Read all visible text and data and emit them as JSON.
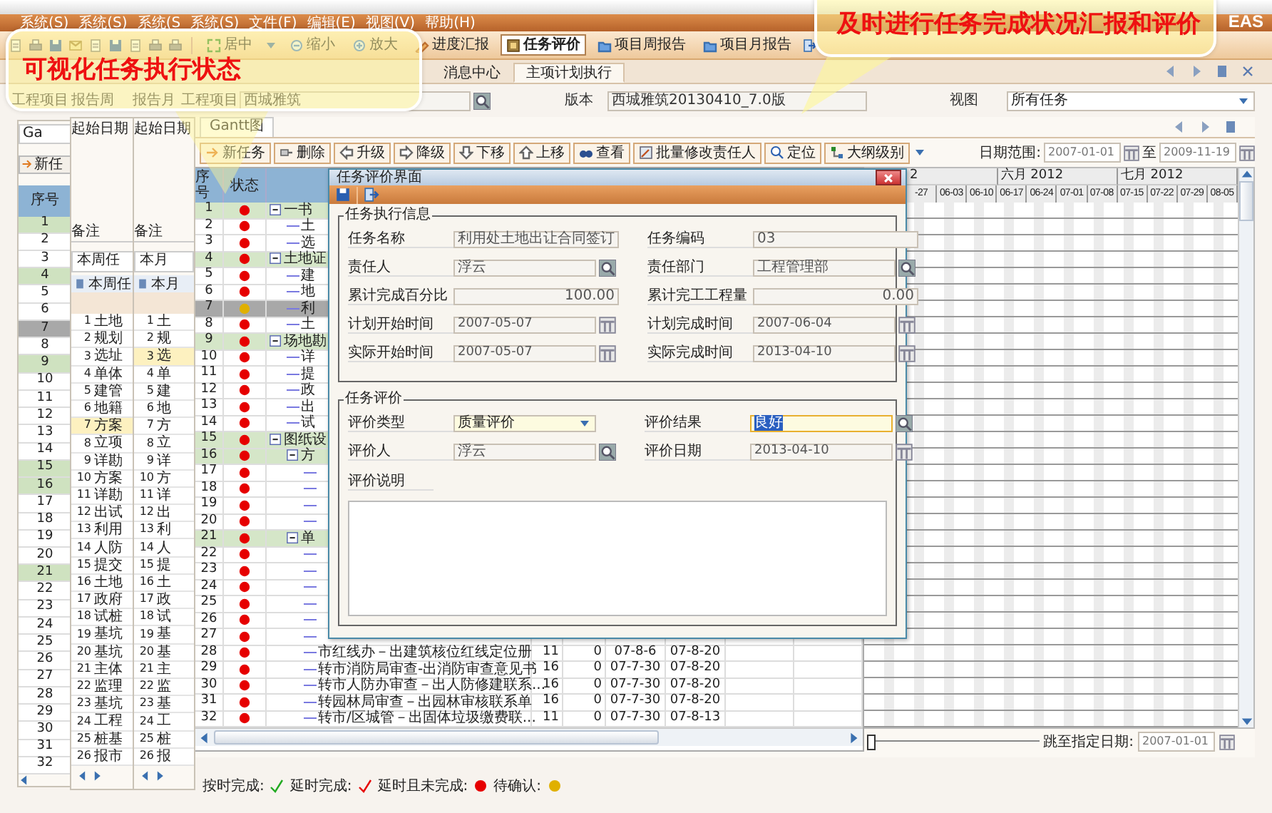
{
  "menu_bar": {
    "items": [
      "系统(S)",
      "系统(S)",
      "系统(S",
      "系统(S)",
      "文件(F)",
      "编辑(E)",
      "视图(V)",
      "帮助(H)"
    ],
    "logo": "EAS"
  },
  "main_toolbar": {
    "buttons": [
      {
        "label": "居中",
        "kind": "center",
        "selected": false
      },
      {
        "label": "缩小",
        "kind": "zoom_out",
        "selected": false
      },
      {
        "label": "放大",
        "kind": "zoom_in",
        "selected": false
      },
      {
        "label": "进度汇报",
        "kind": "report",
        "selected": false
      },
      {
        "label": "任务评价",
        "kind": "evaluate",
        "selected": true
      },
      {
        "label": "项目周报告",
        "kind": "folder",
        "selected": false
      },
      {
        "label": "项目月报告",
        "kind": "folder",
        "selected": false
      }
    ]
  },
  "callouts": [
    {
      "text": "可视化任务执行状态"
    },
    {
      "text": "及时进行任务完成状况汇报和评价"
    }
  ],
  "window_tabs": [
    {
      "label": "消息中心",
      "selected": false
    },
    {
      "label": "主项计划执行",
      "selected": true
    }
  ],
  "filters": {
    "project_label": "工程项目",
    "week_label": "报告周",
    "month_label": "报告月",
    "project_label_2": "工程项目",
    "project": "西城雅筑",
    "version_label": "版本",
    "version": "西城雅筑20130410_7.0版",
    "view_label": "视图",
    "view": "所有任务"
  },
  "left_window": {
    "tab": "Ga",
    "button": "新任",
    "column": "序号",
    "rows": [
      {
        "no": "1",
        "summary": true,
        "selected": false
      },
      {
        "no": "2",
        "summary": false,
        "selected": false
      },
      {
        "no": "3",
        "summary": false,
        "selected": false
      },
      {
        "no": "4",
        "summary": true,
        "selected": false
      },
      {
        "no": "5",
        "summary": false,
        "selected": false
      },
      {
        "no": "6",
        "summary": false,
        "selected": false
      },
      {
        "no": "7",
        "summary": false,
        "selected": true
      },
      {
        "no": "8",
        "summary": false,
        "selected": false
      },
      {
        "no": "9",
        "summary": true,
        "selected": false
      },
      {
        "no": "10",
        "summary": false,
        "selected": false
      },
      {
        "no": "11",
        "summary": false,
        "selected": false
      },
      {
        "no": "12",
        "summary": false,
        "selected": false
      },
      {
        "no": "13",
        "summary": false,
        "selected": false
      },
      {
        "no": "14",
        "summary": false,
        "selected": false
      },
      {
        "no": "15",
        "summary": true,
        "selected": false
      },
      {
        "no": "16",
        "summary": true,
        "selected": false
      },
      {
        "no": "17",
        "summary": false,
        "selected": false
      },
      {
        "no": "18",
        "summary": false,
        "selected": false
      },
      {
        "no": "19",
        "summary": false,
        "selected": false
      },
      {
        "no": "20",
        "summary": false,
        "selected": false
      },
      {
        "no": "21",
        "summary": true,
        "selected": false
      },
      {
        "no": "22",
        "summary": false,
        "selected": false
      },
      {
        "no": "23",
        "summary": false,
        "selected": false
      },
      {
        "no": "24",
        "summary": false,
        "selected": false
      },
      {
        "no": "25",
        "summary": false,
        "selected": false
      },
      {
        "no": "26",
        "summary": false,
        "selected": false
      },
      {
        "no": "27",
        "summary": false,
        "selected": false
      },
      {
        "no": "28",
        "summary": false,
        "selected": false
      },
      {
        "no": "29",
        "summary": false,
        "selected": false
      },
      {
        "no": "30",
        "summary": false,
        "selected": false
      },
      {
        "no": "31",
        "summary": false,
        "selected": false
      },
      {
        "no": "32",
        "summary": false,
        "selected": false
      }
    ]
  },
  "week_window": {
    "start_label": "起始日期",
    "note_label": "备注",
    "tab": "本周任",
    "header": "本周任",
    "rows": [
      {
        "no": "1",
        "name": "土地",
        "selected": false
      },
      {
        "no": "2",
        "name": "规划",
        "selected": false
      },
      {
        "no": "3",
        "name": "选址",
        "selected": false
      },
      {
        "no": "4",
        "name": "单体",
        "selected": false
      },
      {
        "no": "5",
        "name": "建管",
        "selected": false
      },
      {
        "no": "6",
        "name": "地籍",
        "selected": false
      },
      {
        "no": "7",
        "name": "方案",
        "selected": true
      },
      {
        "no": "8",
        "name": "立项",
        "selected": false
      },
      {
        "no": "9",
        "name": "详勘",
        "selected": false
      },
      {
        "no": "10",
        "name": "方案",
        "selected": false
      },
      {
        "no": "11",
        "name": "详勘",
        "selected": false
      },
      {
        "no": "12",
        "name": "出试",
        "selected": false
      },
      {
        "no": "13",
        "name": "利用",
        "selected": false
      },
      {
        "no": "14",
        "name": "人防",
        "selected": false
      },
      {
        "no": "15",
        "name": "提交",
        "selected": false
      },
      {
        "no": "16",
        "name": "土地",
        "selected": false
      },
      {
        "no": "17",
        "name": "政府",
        "selected": false
      },
      {
        "no": "18",
        "name": "试桩",
        "selected": false
      },
      {
        "no": "19",
        "name": "基坑",
        "selected": false
      },
      {
        "no": "20",
        "name": "基坑",
        "selected": false
      },
      {
        "no": "21",
        "name": "主体",
        "selected": false
      },
      {
        "no": "22",
        "name": "监理",
        "selected": false
      },
      {
        "no": "23",
        "name": "基坑",
        "selected": false
      },
      {
        "no": "24",
        "name": "工程",
        "selected": false
      },
      {
        "no": "25",
        "name": "桩基",
        "selected": false
      },
      {
        "no": "26",
        "name": "报市",
        "selected": false
      }
    ]
  },
  "month_window": {
    "start_label": "起始日期",
    "note_label": "备注",
    "tab": "本月",
    "header": "本月",
    "rows": [
      {
        "no": "1",
        "name": "土",
        "selected": false
      },
      {
        "no": "2",
        "name": "规",
        "selected": false
      },
      {
        "no": "3",
        "name": "选",
        "selected": true
      },
      {
        "no": "4",
        "name": "单",
        "selected": false
      },
      {
        "no": "5",
        "name": "建",
        "selected": false
      },
      {
        "no": "6",
        "name": "地",
        "selected": false
      },
      {
        "no": "7",
        "name": "方",
        "selected": false
      },
      {
        "no": "8",
        "name": "立",
        "selected": false
      },
      {
        "no": "9",
        "name": "详",
        "selected": false
      },
      {
        "no": "10",
        "name": "方",
        "selected": false
      },
      {
        "no": "11",
        "name": "详",
        "selected": false
      },
      {
        "no": "12",
        "name": "出",
        "selected": false
      },
      {
        "no": "13",
        "name": "利",
        "selected": false
      },
      {
        "no": "14",
        "name": "人",
        "selected": false
      },
      {
        "no": "15",
        "name": "提",
        "selected": false
      },
      {
        "no": "16",
        "name": "土",
        "selected": false
      },
      {
        "no": "17",
        "name": "政",
        "selected": false
      },
      {
        "no": "18",
        "name": "试",
        "selected": false
      },
      {
        "no": "19",
        "name": "基",
        "selected": false
      },
      {
        "no": "20",
        "name": "基",
        "selected": false
      },
      {
        "no": "21",
        "name": "主",
        "selected": false
      },
      {
        "no": "22",
        "name": "监",
        "selected": false
      },
      {
        "no": "23",
        "name": "基",
        "selected": false
      },
      {
        "no": "24",
        "name": "工",
        "selected": false
      },
      {
        "no": "25",
        "name": "桩",
        "selected": false
      },
      {
        "no": "26",
        "name": "报",
        "selected": false
      }
    ]
  },
  "gantt": {
    "tab": "Gantt图",
    "toolbar": [
      {
        "label": "新任务",
        "kind": "new"
      },
      {
        "label": "删除",
        "kind": "delete"
      },
      {
        "label": "升级",
        "kind": "promote"
      },
      {
        "label": "降级",
        "kind": "demote"
      },
      {
        "label": "下移",
        "kind": "down"
      },
      {
        "label": "上移",
        "kind": "up"
      },
      {
        "label": "查看",
        "kind": "view"
      },
      {
        "label": "批量修改责任人",
        "kind": "reassign"
      },
      {
        "label": "定位",
        "kind": "locate"
      },
      {
        "label": "大纲级别",
        "kind": "outline"
      }
    ],
    "date_range": {
      "label": "日期范围:",
      "from": "2007-01-01",
      "to_label": "至",
      "to": "2009-11-19"
    },
    "columns": [
      "序号",
      "状态"
    ],
    "rows": [
      {
        "no": "1",
        "color": "#e60000",
        "name": "一书",
        "summary": true,
        "selected": false,
        "expanded": true,
        "children": [
          {
            "no": "2",
            "color": "#e60000",
            "name": "土",
            "summary": false,
            "selected": false
          },
          {
            "no": "3",
            "color": "#e60000",
            "name": "选",
            "summary": false,
            "selected": false
          }
        ]
      },
      {
        "no": "4",
        "color": "#e60000",
        "name": "土地证",
        "summary": true,
        "selected": false,
        "expanded": true,
        "children": [
          {
            "no": "5",
            "color": "#e60000",
            "name": "建",
            "summary": false,
            "selected": false
          },
          {
            "no": "6",
            "color": "#e60000",
            "name": "地",
            "summary": false,
            "selected": false
          },
          {
            "no": "7",
            "color": "#e0b000",
            "name": "利",
            "summary": false,
            "selected": true
          },
          {
            "no": "8",
            "color": "#e60000",
            "name": "土",
            "summary": false,
            "selected": false
          }
        ]
      },
      {
        "no": "9",
        "color": "#e60000",
        "name": "场地勘",
        "summary": true,
        "selected": false,
        "expanded": true,
        "children": [
          {
            "no": "10",
            "color": "#e60000",
            "name": "详",
            "summary": false,
            "selected": false
          },
          {
            "no": "11",
            "color": "#e60000",
            "name": "提",
            "summary": false,
            "selected": false
          },
          {
            "no": "12",
            "color": "#e60000",
            "name": "政",
            "summary": false,
            "selected": false
          },
          {
            "no": "13",
            "color": "#e60000",
            "name": "出",
            "summary": false,
            "selected": false
          },
          {
            "no": "14",
            "color": "#e60000",
            "name": "试",
            "summary": false,
            "selected": false
          }
        ]
      },
      {
        "no": "15",
        "color": "#e60000",
        "name": "图纸设",
        "summary": true,
        "selected": false,
        "expanded": true,
        "children": [
          {
            "no": "16",
            "color": "#e60000",
            "name": "方",
            "summary": true,
            "selected": false,
            "expanded": true,
            "children": [
              {
                "no": "17",
                "color": "#e60000",
                "summary": false,
                "selected": false
              },
              {
                "no": "18",
                "color": "#e60000",
                "summary": false,
                "selected": false
              },
              {
                "no": "19",
                "color": "#e60000",
                "summary": false,
                "selected": false
              },
              {
                "no": "20",
                "color": "#e60000",
                "summary": false,
                "selected": false
              }
            ]
          },
          {
            "no": "21",
            "color": "#e60000",
            "name": "单",
            "summary": true,
            "selected": false,
            "expanded": true,
            "children": [
              {
                "no": "22",
                "color": "#e60000",
                "summary": false,
                "selected": false
              },
              {
                "no": "23",
                "color": "#e60000",
                "summary": false,
                "selected": false
              },
              {
                "no": "24",
                "color": "#e60000",
                "summary": false,
                "selected": false
              },
              {
                "no": "25",
                "color": "#e60000",
                "summary": false,
                "selected": false
              },
              {
                "no": "26",
                "color": "#e60000",
                "summary": false,
                "selected": false
              },
              {
                "no": "27",
                "color": "#e60000",
                "summary": false,
                "selected": false
              },
              {
                "no": "28",
                "color": "#e60000",
                "name": "市红线办－出建筑核位红线定位册",
                "summary": false,
                "selected": false,
                "values": [
                  "11",
                  "0",
                  "07-8-6",
                  "07-8-20"
                ]
              },
              {
                "no": "29",
                "color": "#e60000",
                "name": "转市消防局审查-出消防审查意见书",
                "summary": false,
                "selected": false,
                "values": [
                  "16",
                  "0",
                  "07-7-30",
                  "07-8-20"
                ]
              },
              {
                "no": "30",
                "color": "#e60000",
                "name": "转市人防办审查－出人防修建联系...",
                "summary": false,
                "selected": false,
                "values": [
                  "16",
                  "0",
                  "07-7-30",
                  "07-8-20"
                ]
              },
              {
                "no": "31",
                "color": "#e60000",
                "name": "转园林局审查－出园林审核联系单",
                "summary": false,
                "selected": false,
                "values": [
                  "16",
                  "0",
                  "07-7-30",
                  "07-8-20"
                ]
              },
              {
                "no": "32",
                "color": "#e60000",
                "name": "转市/区城管－出固体垃圾缴费联...",
                "summary": false,
                "selected": false,
                "values": [
                  "11",
                  "0",
                  "07-7-30",
                  "07-8-13"
                ]
              }
            ]
          }
        ]
      }
    ],
    "timeline": {
      "months": [
        "2",
        "六月 2012",
        "七月 2012"
      ],
      "weeks": [
        "-27",
        "06-03",
        "06-10",
        "06-17",
        "06-24",
        "07-01",
        "07-08",
        "07-15",
        "07-22",
        "07-29",
        "08-05"
      ]
    },
    "jump": {
      "label": "跳至指定日期:",
      "date": "2007-01-01",
      "level": 0
    }
  },
  "dialog": {
    "title": "任务评价界面",
    "sections": [
      {
        "title": "任务执行信息",
        "fields": [
          {
            "label": "任务名称",
            "value": "利用处土地出让合同签订",
            "kind": "text"
          },
          {
            "label": "任务编码",
            "value": "03",
            "kind": "text"
          },
          {
            "label": "责任人",
            "value": "浮云",
            "kind": "lookup"
          },
          {
            "label": "责任部门",
            "value": "工程管理部",
            "kind": "lookup"
          },
          {
            "label": "累计完成百分比",
            "value": "100.00",
            "kind": "number"
          },
          {
            "label": "累计完工工程量",
            "value": "0.00",
            "kind": "number"
          },
          {
            "label": "计划开始时间",
            "value": "2007-05-07",
            "kind": "date"
          },
          {
            "label": "计划完成时间",
            "value": "2007-06-04",
            "kind": "date"
          },
          {
            "label": "实际开始时间",
            "value": "2007-05-07",
            "kind": "date"
          },
          {
            "label": "实际完成时间",
            "value": "2013-04-10",
            "kind": "date"
          }
        ]
      },
      {
        "title": "任务评价",
        "fields": [
          {
            "label": "评价类型",
            "value": "质量评价",
            "kind": "select"
          },
          {
            "label": "评价结果",
            "value": "良好",
            "kind": "picker"
          },
          {
            "label": "评价人",
            "value": "浮云",
            "kind": "lookup"
          },
          {
            "label": "评价日期",
            "value": "2013-04-10",
            "kind": "date"
          }
        ],
        "note_label": "评价说明"
      }
    ]
  },
  "legend": [
    {
      "label": "按时完成:",
      "kind": "check",
      "color": "#22aa22"
    },
    {
      "label": "延时完成:",
      "kind": "check",
      "color": "#e60000"
    },
    {
      "label": "延时且未完成:",
      "kind": "dot",
      "color": "#e60000"
    },
    {
      "label": "待确认:",
      "kind": "dot",
      "color": "#e0b000"
    }
  ]
}
